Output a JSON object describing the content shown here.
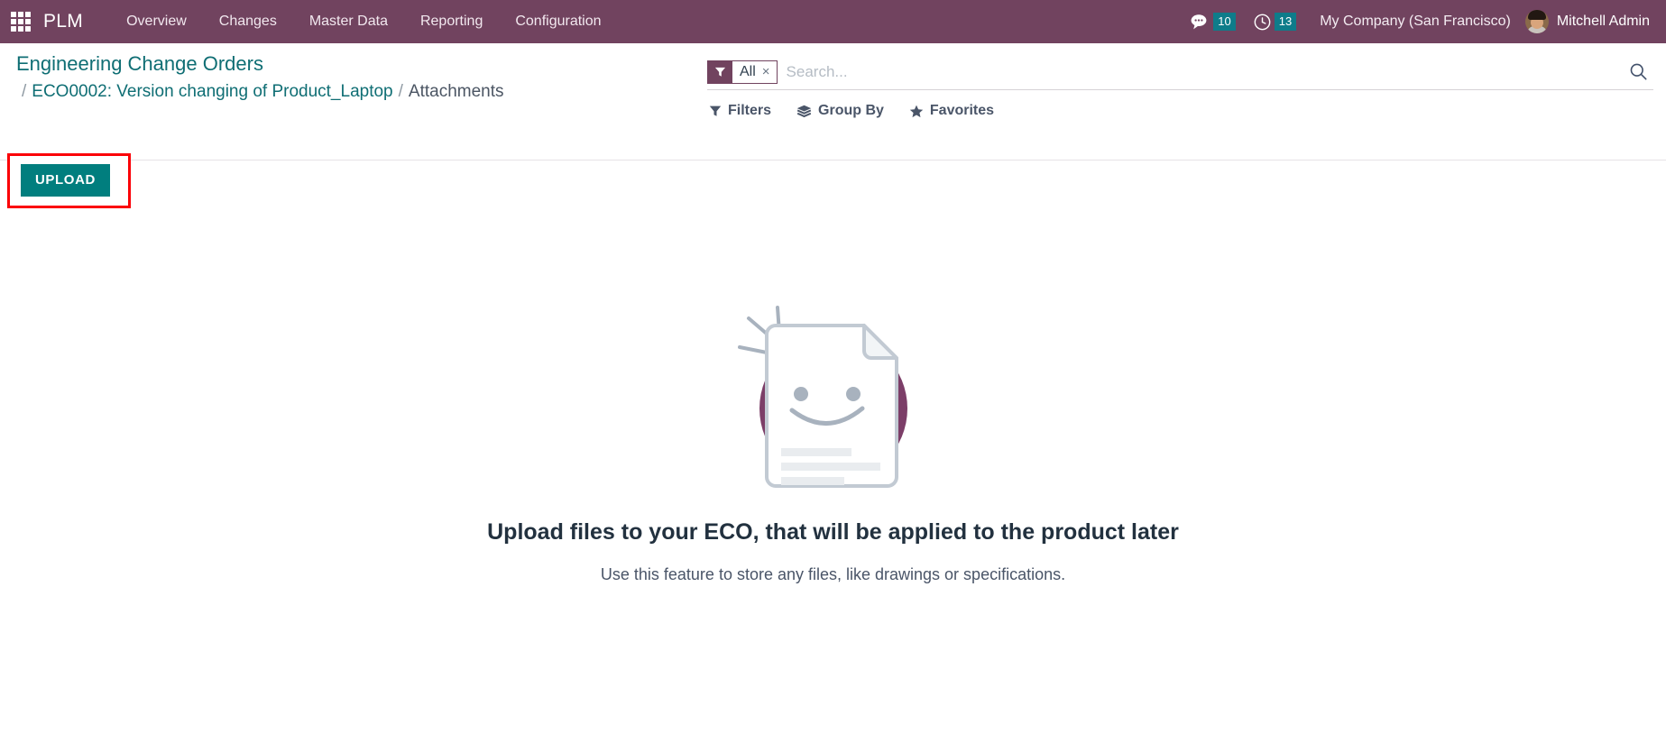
{
  "navbar": {
    "apps_icon": "apps-grid-icon",
    "brand": "PLM",
    "menu": [
      {
        "label": "Overview"
      },
      {
        "label": "Changes"
      },
      {
        "label": "Master Data"
      },
      {
        "label": "Reporting"
      },
      {
        "label": "Configuration"
      }
    ],
    "messages": {
      "icon": "comments-icon",
      "count": "10"
    },
    "activities": {
      "icon": "clock-icon",
      "count": "13"
    },
    "company": "My Company (San Francisco)",
    "user": "Mitchell Admin"
  },
  "breadcrumb": {
    "root": "Engineering Change Orders",
    "sep": "/",
    "record": "ECO0002: Version changing of Product_Laptop",
    "current": "Attachments"
  },
  "actions": {
    "upload_label": "UPLOAD"
  },
  "search": {
    "facet_label": "All",
    "facet_remove": "×",
    "placeholder": "Search...",
    "value": "",
    "search_icon": "magnifier-icon"
  },
  "filter_buttons": [
    {
      "label": "Filters",
      "icon": "funnel-icon"
    },
    {
      "label": "Group By",
      "icon": "layers-icon"
    },
    {
      "label": "Favorites",
      "icon": "star-icon"
    }
  ],
  "empty_state": {
    "illustration": "smiling-document-icon",
    "title": "Upload files to your ECO, that will be applied to the product later",
    "subtitle": "Use this feature to store any files, like drawings or specifications."
  },
  "colors": {
    "navbar_purple": "#71435F",
    "accent_teal": "#017E7E",
    "badge_teal": "#0E7C8A",
    "breadcrumb_link": "#0F6E74",
    "highlight_red": "#FB0007",
    "illustration_purple": "#7C3E68",
    "illustration_grey": "#A8B2BE"
  }
}
